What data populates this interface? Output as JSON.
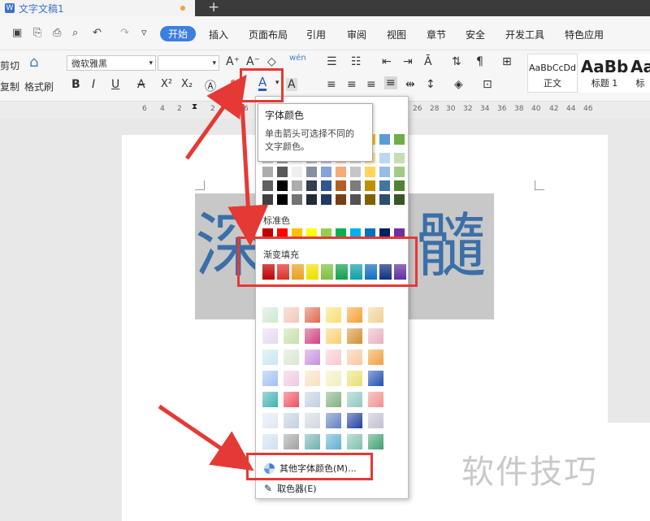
{
  "window": {
    "doc_tab": "文字文稿1",
    "new_tab": "+",
    "logo": "W"
  },
  "menu": {
    "start": "开始",
    "items": [
      "插入",
      "页面布局",
      "引用",
      "审阅",
      "视图",
      "章节",
      "安全",
      "开发工具",
      "特色应用"
    ]
  },
  "ribbon": {
    "cut": "剪切",
    "copy": "复制",
    "format_painter": "格式刷",
    "font_name": "微软雅黑",
    "font_size": "",
    "bold": "B",
    "italic": "I",
    "underline": "U",
    "strike": "A",
    "superscript": "X²",
    "subscript": "X₂",
    "font_color": "A",
    "char_shade": "A",
    "styles": [
      {
        "sample": "AaBbCcDd",
        "name": "正文"
      },
      {
        "sample": "AaBb",
        "name": "标题 1"
      },
      {
        "sample": "Aa",
        "name": "标"
      }
    ]
  },
  "ruler": {
    "numbers": [
      "6",
      "4",
      "2",
      "2",
      "6",
      "26",
      "28",
      "30",
      "32",
      "34",
      "36",
      "38",
      "40",
      "42",
      "44",
      "46"
    ]
  },
  "document": {
    "chars": [
      "深",
      "髓"
    ]
  },
  "tooltip": {
    "title": "字体颜色",
    "desc_line1": "单击箭头可选择不同的",
    "desc_line2": "文字颜色。"
  },
  "dropdown": {
    "standard_label": "标准色",
    "gradient_label": "渐变填充",
    "more_colors": "其他字体颜色(M)...",
    "picker": "取色器(E)",
    "theme_colors": [
      "#ffffff",
      "#000000",
      "#e7e6e6",
      "#44546a",
      "#4472c4",
      "#ed7d31",
      "#a5a5a5",
      "#ffc000",
      "#5b9bd5",
      "#70ad47"
    ],
    "standard_colors": [
      "#c00000",
      "#ff0000",
      "#ffc000",
      "#ffff00",
      "#92d050",
      "#00b050",
      "#00b0f0",
      "#0070c0",
      "#002060",
      "#7030a0"
    ],
    "gradient_colors": [
      "#c00000",
      "#e0302a",
      "#e8a020",
      "#f0e000",
      "#80c040",
      "#10a050",
      "#10a0a8",
      "#1070c0",
      "#103080",
      "#6030a0"
    ]
  },
  "watermark": "软件技巧"
}
